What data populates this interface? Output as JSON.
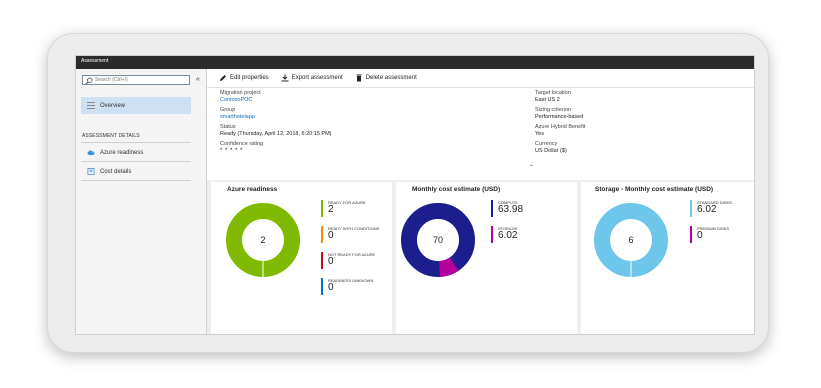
{
  "window": {
    "title": "Assessment"
  },
  "sidebar": {
    "search_placeholder": "Search (Ctrl+/)",
    "collapse_glyph": "«",
    "overview_label": "Overview",
    "section_label": "ASSESSMENT DETAILS",
    "items": [
      {
        "label": "Azure readiness",
        "icon": "cloud-icon"
      },
      {
        "label": "Cost details",
        "icon": "report-icon"
      }
    ]
  },
  "toolbar": {
    "edit_label": "Edit properties",
    "export_label": "Export assessment",
    "delete_label": "Delete assessment"
  },
  "essentials": {
    "left": [
      {
        "label": "Migration project",
        "value": "ContosoPOC",
        "link": true
      },
      {
        "label": "Group",
        "value": "smarthotelapp",
        "link": true
      },
      {
        "label": "Status",
        "value": "Ready (Thursday, April 12, 2018, 6:20:15 PM)",
        "link": false
      },
      {
        "label": "Confidence rating",
        "value": "* * * * *",
        "link": false
      }
    ],
    "right": [
      {
        "label": "Target location",
        "value": "East US 2"
      },
      {
        "label": "Sizing criterion",
        "value": "Performance-based"
      },
      {
        "label": "Azure Hybrid Benefit",
        "value": "Yes"
      },
      {
        "label": "Currency",
        "value": "US Dollar ($)"
      }
    ],
    "collapse_glyph": "⌃"
  },
  "tiles": {
    "readiness": {
      "title": "Azure readiness",
      "center": "2",
      "legend": [
        {
          "label": "READY FOR AZURE",
          "value": "2",
          "color": "#7fba00"
        },
        {
          "label": "READY WITH CONDITIONS",
          "value": "0",
          "color": "#ff8c00"
        },
        {
          "label": "NOT READY FOR AZURE",
          "value": "0",
          "color": "#c50f1f"
        },
        {
          "label": "READINESS UNKNOWN",
          "value": "0",
          "color": "#0072c6"
        }
      ]
    },
    "cost": {
      "title": "Monthly cost estimate (USD)",
      "center": "70",
      "legend": [
        {
          "label": "COMPUTE",
          "value": "63.98",
          "color": "#1b1e8c"
        },
        {
          "label": "STORAGE",
          "value": "6.02",
          "color": "#b4009e"
        }
      ]
    },
    "storage": {
      "title": "Storage - Monthly cost estimate (USD)",
      "center": "6",
      "legend": [
        {
          "label": "STANDARD DISKS",
          "value": "6.02",
          "color": "#6ec6ea"
        },
        {
          "label": "PREMIUM DISKS",
          "value": "0",
          "color": "#b4009e"
        }
      ]
    }
  }
}
